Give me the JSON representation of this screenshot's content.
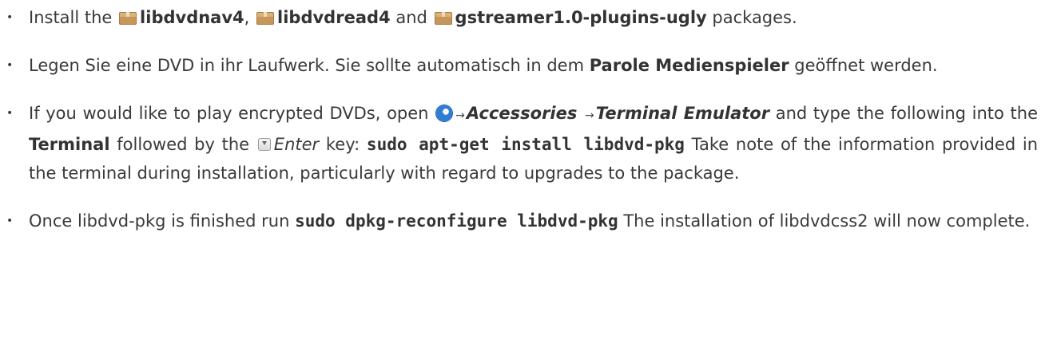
{
  "items": [
    {
      "lead": "Install the",
      "pkg1": "libdvdnav4",
      "sep1": ",",
      "pkg2": "libdvdread4",
      "and": "and",
      "pkg3": "gstreamer1.0-plugins-ugly",
      "tail": "packages."
    },
    {
      "text1": "Legen Sie eine DVD in ihr Laufwerk. Sie sollte automatisch in dem",
      "player": "Parole Medienspieler",
      "text2": "geöffnet werden."
    },
    {
      "text1": "If you would like to play encrypted DVDs, open",
      "menu1": "Accessories",
      "menu2": "Terminal Emulator",
      "text2": "and type the following into the",
      "terminal": "Terminal",
      "text3": "followed by the",
      "key": "Enter",
      "text4": "key:",
      "command": "sudo apt-get install libdvd-pkg",
      "text5": "Take note of the information provided in the terminal during installation, particularly with regard to upgrades to the package."
    },
    {
      "text1": "Once libdvd-pkg is finished run",
      "command": "sudo dpkg-reconfigure libdvd-pkg",
      "text2": "The installation of libdvdcss2 will now complete."
    }
  ],
  "icons": {
    "package": "package-icon",
    "menu": "applications-menu-icon",
    "enter_key": "enter-key-icon",
    "arrow": "→"
  }
}
